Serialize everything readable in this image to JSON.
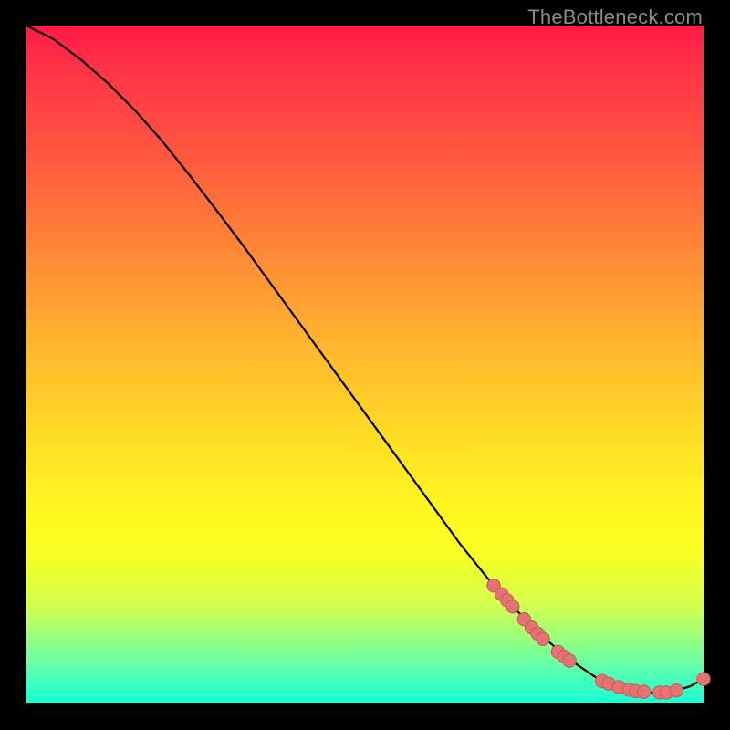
{
  "watermark": "TheBottleneck.com",
  "colors": {
    "page_bg": "#000000",
    "curve": "#000000",
    "marker_fill": "#e57373",
    "marker_stroke": "#c85a5a"
  },
  "chart_data": {
    "type": "line",
    "title": "",
    "xlabel": "",
    "ylabel": "",
    "xlim": [
      0,
      100
    ],
    "ylim": [
      0,
      100
    ],
    "grid": false,
    "legend": false,
    "series": [
      {
        "name": "bottleneck-curve",
        "x": [
          0,
          4,
          8,
          12,
          16,
          20,
          24,
          28,
          32,
          36,
          40,
          44,
          48,
          52,
          56,
          60,
          64,
          68,
          72,
          76,
          80,
          84,
          86,
          88,
          90,
          92,
          94,
          96,
          98,
          100
        ],
        "y": [
          100,
          98,
          95,
          91.5,
          87.5,
          83,
          78,
          72.8,
          67.5,
          62,
          56.5,
          51,
          45.5,
          40,
          34.5,
          29,
          23.5,
          18.5,
          14,
          10,
          6.5,
          3.8,
          2.8,
          2.1,
          1.7,
          1.5,
          1.5,
          1.8,
          2.4,
          3.5
        ]
      }
    ],
    "markers": [
      {
        "x": 69,
        "y": 17.3
      },
      {
        "x": 70.2,
        "y": 16.0
      },
      {
        "x": 71,
        "y": 15.1
      },
      {
        "x": 71.8,
        "y": 14.2
      },
      {
        "x": 73.5,
        "y": 12.3
      },
      {
        "x": 74.6,
        "y": 11.1
      },
      {
        "x": 75.5,
        "y": 10.2
      },
      {
        "x": 76.3,
        "y": 9.4
      },
      {
        "x": 78.5,
        "y": 7.5
      },
      {
        "x": 79.4,
        "y": 6.8
      },
      {
        "x": 80.2,
        "y": 6.2
      },
      {
        "x": 85.0,
        "y": 3.2
      },
      {
        "x": 86.0,
        "y": 2.8
      },
      {
        "x": 87.5,
        "y": 2.3
      },
      {
        "x": 89.0,
        "y": 1.9
      },
      {
        "x": 90.0,
        "y": 1.7
      },
      {
        "x": 91.2,
        "y": 1.6
      },
      {
        "x": 93.5,
        "y": 1.5
      },
      {
        "x": 94.5,
        "y": 1.5
      },
      {
        "x": 96.0,
        "y": 1.8
      },
      {
        "x": 100.0,
        "y": 3.5
      }
    ]
  }
}
